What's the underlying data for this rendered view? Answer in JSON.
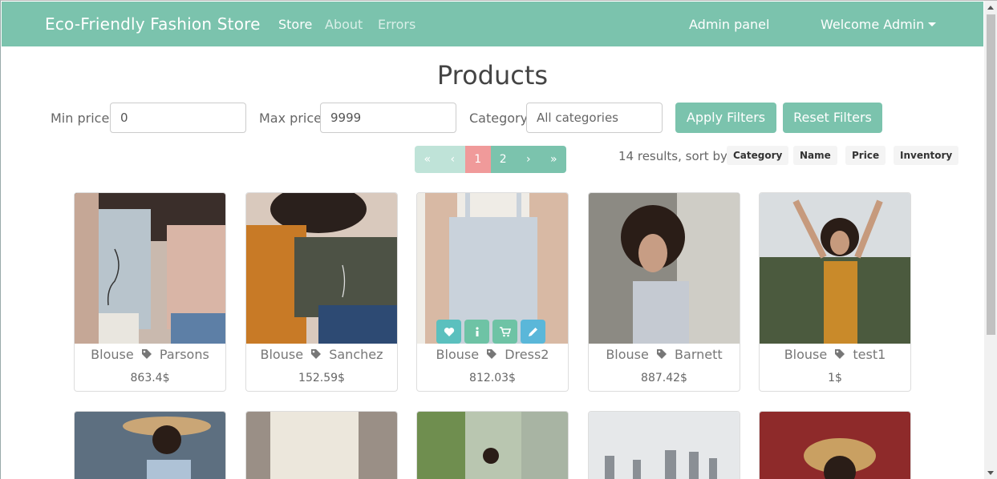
{
  "navbar": {
    "brand": "Eco-Friendly Fashion Store",
    "links": [
      "Store",
      "About",
      "Errors"
    ],
    "admin_panel": "Admin panel",
    "welcome": "Welcome Admin"
  },
  "page_title": "Products",
  "filters": {
    "min_label": "Min price:",
    "min_value": "0",
    "max_label": "Max price:",
    "max_value": "9999",
    "category_label": "Category:",
    "category_value": "All categories",
    "apply": "Apply Filters",
    "reset": "Reset Filters"
  },
  "pagination": {
    "first": "«",
    "prev": "‹",
    "pages": [
      "1",
      "2"
    ],
    "current_page": "1",
    "next": "›",
    "last": "»"
  },
  "results": {
    "text": "14 results, sort by:",
    "sort_options": [
      "Category",
      "Name",
      "Price",
      "Inventory"
    ]
  },
  "products": [
    {
      "category": "Blouse",
      "name": "Parsons",
      "price": "863.4$"
    },
    {
      "category": "Blouse",
      "name": "Sanchez",
      "price": "152.59$"
    },
    {
      "category": "Blouse",
      "name": "Dress2",
      "price": "812.03$"
    },
    {
      "category": "Blouse",
      "name": "Barnett",
      "price": "887.42$"
    },
    {
      "category": "Blouse",
      "name": "test1",
      "price": "1$"
    }
  ],
  "card_actions": [
    "heart-icon",
    "info-icon",
    "cart-icon",
    "pencil-icon"
  ],
  "colors": {
    "accent": "#7bc3ad",
    "current_page": "#f09a9a",
    "action_teal": "#5bc0be"
  }
}
